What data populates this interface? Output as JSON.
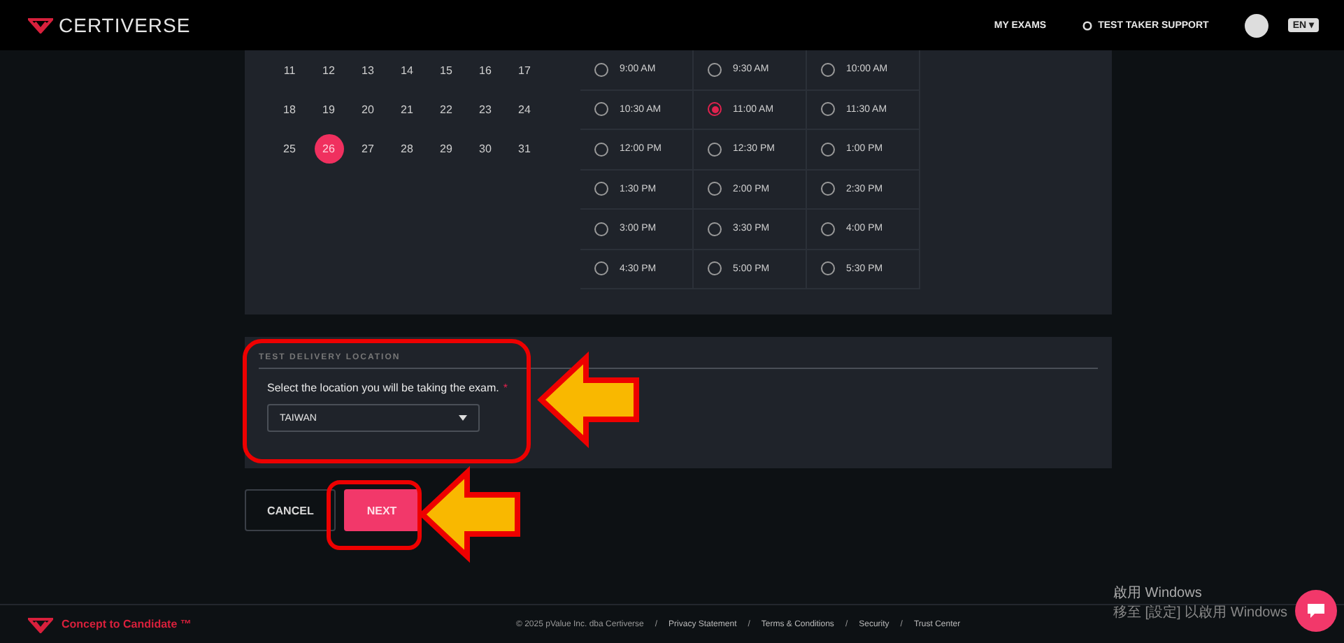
{
  "header": {
    "brand": "CERTIVERSE",
    "nav": [
      {
        "label": "MY EXAMS",
        "kind": "link"
      },
      {
        "label": "TEST TAKER SUPPORT",
        "kind": "support"
      }
    ],
    "language": "EN",
    "caret": "▾"
  },
  "calendar": {
    "days": [
      {
        "label": "11",
        "selected": false
      },
      {
        "label": "12",
        "selected": false
      },
      {
        "label": "13",
        "selected": false
      },
      {
        "label": "14",
        "selected": false
      },
      {
        "label": "15",
        "selected": false
      },
      {
        "label": "16",
        "selected": false
      },
      {
        "label": "17",
        "selected": false
      },
      {
        "label": "18",
        "selected": false
      },
      {
        "label": "19",
        "selected": false
      },
      {
        "label": "20",
        "selected": false
      },
      {
        "label": "21",
        "selected": false
      },
      {
        "label": "22",
        "selected": false
      },
      {
        "label": "23",
        "selected": false
      },
      {
        "label": "24",
        "selected": false
      },
      {
        "label": "25",
        "selected": false
      },
      {
        "label": "26",
        "selected": true
      },
      {
        "label": "27",
        "selected": false
      },
      {
        "label": "28",
        "selected": false
      },
      {
        "label": "29",
        "selected": false
      },
      {
        "label": "30",
        "selected": false
      },
      {
        "label": "31",
        "selected": false
      }
    ]
  },
  "time_slots": [
    {
      "label": "9:00 AM",
      "selected": false
    },
    {
      "label": "9:30 AM",
      "selected": false
    },
    {
      "label": "10:00 AM",
      "selected": false
    },
    {
      "label": "10:30 AM",
      "selected": false
    },
    {
      "label": "11:00 AM",
      "selected": true
    },
    {
      "label": "11:30 AM",
      "selected": false
    },
    {
      "label": "12:00 PM",
      "selected": false
    },
    {
      "label": "12:30 PM",
      "selected": false
    },
    {
      "label": "1:00 PM",
      "selected": false
    },
    {
      "label": "1:30 PM",
      "selected": false
    },
    {
      "label": "2:00 PM",
      "selected": false
    },
    {
      "label": "2:30 PM",
      "selected": false
    },
    {
      "label": "3:00 PM",
      "selected": false
    },
    {
      "label": "3:30 PM",
      "selected": false
    },
    {
      "label": "4:00 PM",
      "selected": false
    },
    {
      "label": "4:30 PM",
      "selected": false
    },
    {
      "label": "5:00 PM",
      "selected": false
    },
    {
      "label": "5:30 PM",
      "selected": false
    }
  ],
  "location": {
    "heading": "TEST DELIVERY LOCATION",
    "label": "Select the location you will be taking the exam.",
    "required_mark": "*",
    "value": "TAIWAN"
  },
  "buttons": [
    {
      "label": "CANCEL",
      "kind": "secondary"
    },
    {
      "label": "NEXT",
      "kind": "primary"
    }
  ],
  "footer": {
    "tagline": "Concept to Candidate",
    "trademark": "™",
    "links": [
      "© 2025 pValue Inc. dba Certiverse",
      "Privacy Statement",
      "Terms & Conditions",
      "Security",
      "Trust Center"
    ],
    "separator": "/"
  },
  "os_notice": {
    "title": "啟用 Windows",
    "hint": "移至 [設定] 以啟用 Windows"
  }
}
